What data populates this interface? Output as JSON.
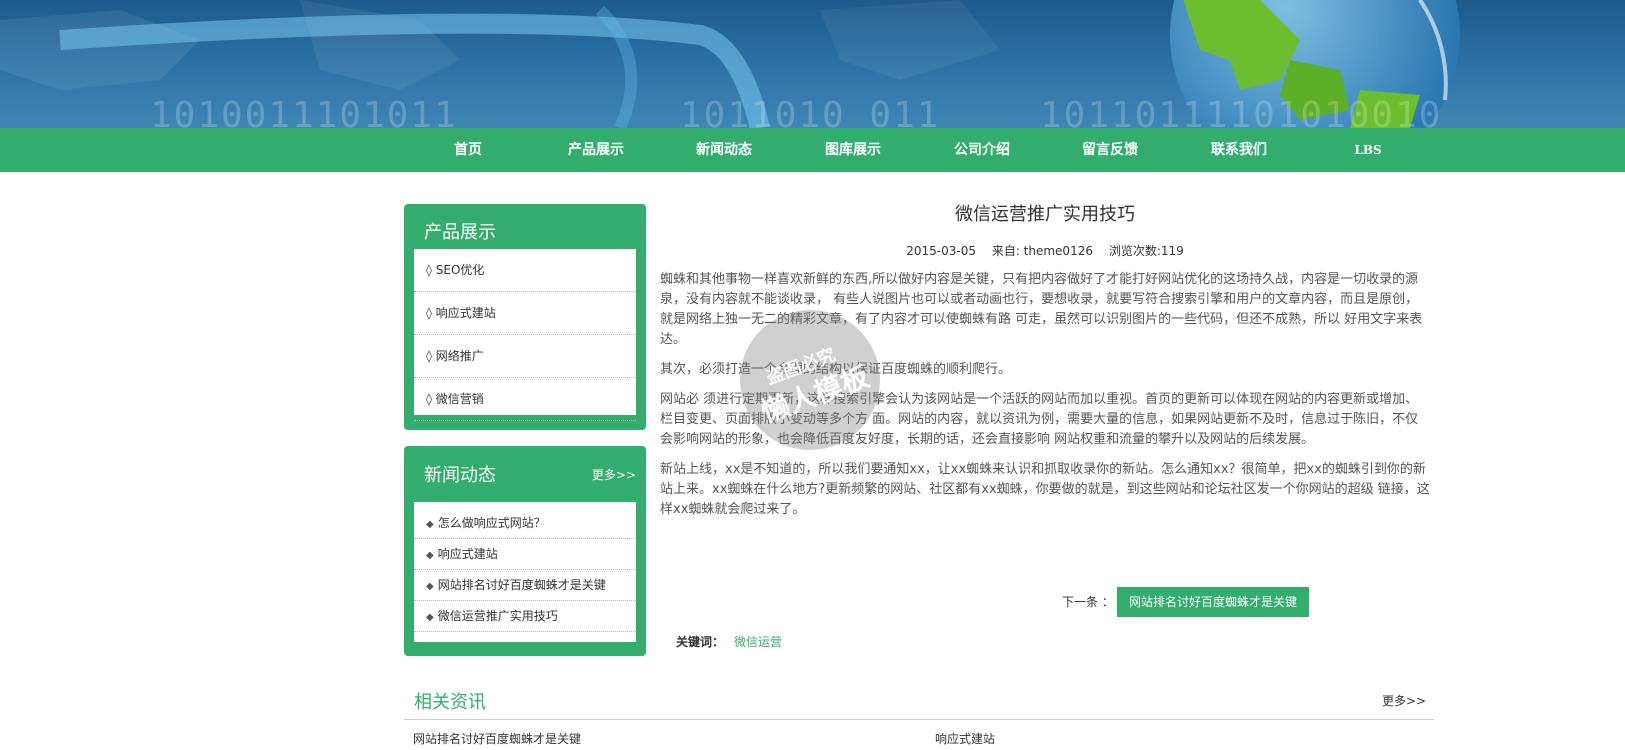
{
  "banner": {
    "binary_1": "1010011101011",
    "binary_2": "1011010  011",
    "binary_3": "10110111101010010"
  },
  "nav": {
    "items": [
      "首页",
      "产品展示",
      "新闻动态",
      "图库展示",
      "公司介绍",
      "留言反馈",
      "联系我们",
      "LBS"
    ]
  },
  "products": {
    "title": "产品展示",
    "items": [
      "◊ SEO优化",
      "◊ 响应式建站",
      "◊ 网络推广",
      "◊ 微信营销"
    ]
  },
  "news": {
    "title": "新闻动态",
    "more": "更多>>",
    "items": [
      "怎么做响应式网站？",
      "响应式建站",
      "网站排名讨好百度蜘蛛才是关键",
      "微信运营推广实用技巧"
    ]
  },
  "article": {
    "title": "微信运营推广实用技巧",
    "date": "2015-03-05",
    "source": "来自: theme0126",
    "views": "浏览次数:119",
    "paragraphs": [
      "蜘蛛和其他事物一样喜欢新鲜的东西,所以做好内容是关键，只有把内容做好了才能打好网站优化的这场持久战，内容是一切收录的源泉，没有内容就不能谈收录， 有些人说图片也可以或者动画也行，要想收录，就要写符合搜索引擎和用户的文章内容，而且是原创，就是网络上独一无二的精彩文章，有了内容才可以使蜘蛛有路 可走，虽然可以识别图片的一些代码，但还不成熟，所以 好用文字来表达。",
      "其次，必须打造一个合理的结构以保证百度蜘蛛的顺利爬行。",
      "网站必 须进行定期更新，这样搜索引擎会认为该网站是一个活跃的网站而加以重视。首页的更新可以体现在网站的内容更新或增加、栏目变更、页面排版小变动等多个方 面。网站的内容，就以资讯为例，需要大量的信息，如果网站更新不及时，信息过于陈旧，不仅会影响网站的形象，也会降低百度友好度，长期的话，还会直接影响 网站权重和流量的攀升以及网站的后续发展。",
      "新站上线，xx是不知道的，所以我们要通知xx，让xx蜘蛛来认识和抓取收录你的新站。怎么通知xx？很简单，把xx的蜘蛛引到你的新站上来。xx蜘蛛在什么地方?更新频繁的网站、社区都有xx蜘蛛，你要做的就是，到这些网站和论坛社区发一个你网站的超级 链接，这样xx蜘蛛就会爬过来了。"
    ],
    "next_label": "下一条 ：",
    "next_link": "网站排名讨好百度蜘蛛才是关键",
    "keyword_label": "关键词：",
    "keyword": "微信运营"
  },
  "related": {
    "title": "相关资讯",
    "more": "更多>>",
    "items": [
      "网站排名讨好百度蜘蛛才是关键",
      "响应式建站"
    ]
  },
  "watermark": {
    "line1": "盗图必究",
    "line2": "懒人模板"
  },
  "colors": {
    "accent": "#33ad6d",
    "banner": "#2a6fa3"
  }
}
